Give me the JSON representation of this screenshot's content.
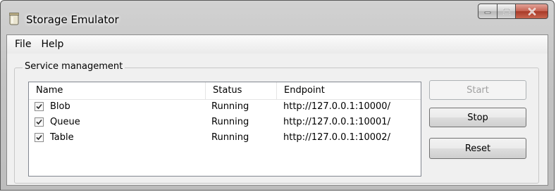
{
  "window": {
    "title": "Storage Emulator",
    "icon": "storage-jar-icon",
    "caption_buttons": [
      "minimize-icon",
      "maximize-icon",
      "close-icon"
    ]
  },
  "menu": [
    {
      "label": "File"
    },
    {
      "label": "Help"
    }
  ],
  "service_management": {
    "label": "Service management",
    "columns": [
      "Name",
      "Status",
      "Endpoint"
    ],
    "rows": [
      {
        "checked": true,
        "name": "Blob",
        "status": "Running",
        "endpoint": "http://127.0.0.1:10000/"
      },
      {
        "checked": true,
        "name": "Queue",
        "status": "Running",
        "endpoint": "http://127.0.0.1:10001/"
      },
      {
        "checked": true,
        "name": "Table",
        "status": "Running",
        "endpoint": "http://127.0.0.1:10002/"
      }
    ]
  },
  "buttons": {
    "start": {
      "label": "Start",
      "enabled": false
    },
    "stop": {
      "label": "Stop",
      "enabled": true
    },
    "reset": {
      "label": "Reset",
      "enabled": true
    }
  }
}
